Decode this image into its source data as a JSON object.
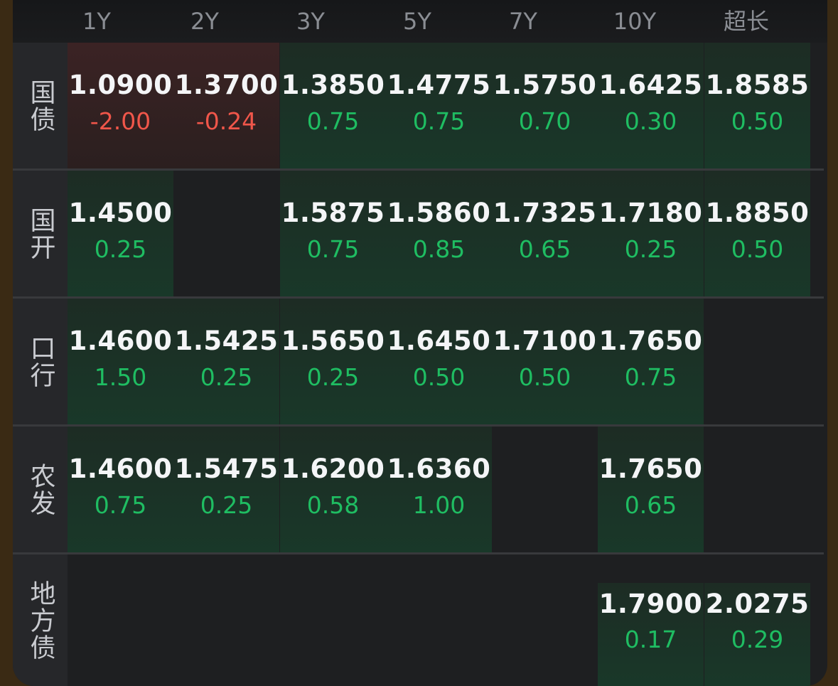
{
  "colors": {
    "up": "#1fbd62",
    "down": "#f0564a",
    "value": "#f4f5f7"
  },
  "columns": [
    "1Y",
    "2Y",
    "3Y",
    "5Y",
    "7Y",
    "10Y",
    "超长"
  ],
  "rows": [
    {
      "label": "国债",
      "cells": [
        {
          "value": "1.0900",
          "change": "-2.00",
          "dir": "down"
        },
        {
          "value": "1.3700",
          "change": "-0.24",
          "dir": "down"
        },
        {
          "value": "1.3850",
          "change": "0.75",
          "dir": "up"
        },
        {
          "value": "1.4775",
          "change": "0.75",
          "dir": "up"
        },
        {
          "value": "1.5750",
          "change": "0.70",
          "dir": "up"
        },
        {
          "value": "1.6425",
          "change": "0.30",
          "dir": "up"
        },
        {
          "value": "1.8585",
          "change": "0.50",
          "dir": "up"
        }
      ]
    },
    {
      "label": "国开",
      "cells": [
        {
          "value": "1.4500",
          "change": "0.25",
          "dir": "up"
        },
        null,
        {
          "value": "1.5875",
          "change": "0.75",
          "dir": "up"
        },
        {
          "value": "1.5860",
          "change": "0.85",
          "dir": "up"
        },
        {
          "value": "1.7325",
          "change": "0.65",
          "dir": "up"
        },
        {
          "value": "1.7180",
          "change": "0.25",
          "dir": "up"
        },
        {
          "value": "1.8850",
          "change": "0.50",
          "dir": "up"
        }
      ]
    },
    {
      "label": "口行",
      "cells": [
        {
          "value": "1.4600",
          "change": "1.50",
          "dir": "up"
        },
        {
          "value": "1.5425",
          "change": "0.25",
          "dir": "up"
        },
        {
          "value": "1.5650",
          "change": "0.25",
          "dir": "up"
        },
        {
          "value": "1.6450",
          "change": "0.50",
          "dir": "up"
        },
        {
          "value": "1.7100",
          "change": "0.50",
          "dir": "up"
        },
        {
          "value": "1.7650",
          "change": "0.75",
          "dir": "up"
        },
        null
      ]
    },
    {
      "label": "农发",
      "cells": [
        {
          "value": "1.4600",
          "change": "0.75",
          "dir": "up"
        },
        {
          "value": "1.5475",
          "change": "0.25",
          "dir": "up"
        },
        {
          "value": "1.6200",
          "change": "0.58",
          "dir": "up"
        },
        {
          "value": "1.6360",
          "change": "1.00",
          "dir": "up"
        },
        null,
        {
          "value": "1.7650",
          "change": "0.65",
          "dir": "up"
        },
        null
      ]
    },
    {
      "label": "地方债",
      "cells": [
        null,
        null,
        null,
        null,
        null,
        {
          "value": "1.7900",
          "change": "0.17",
          "dir": "up"
        },
        {
          "value": "2.0275",
          "change": "0.29",
          "dir": "up"
        }
      ]
    }
  ]
}
